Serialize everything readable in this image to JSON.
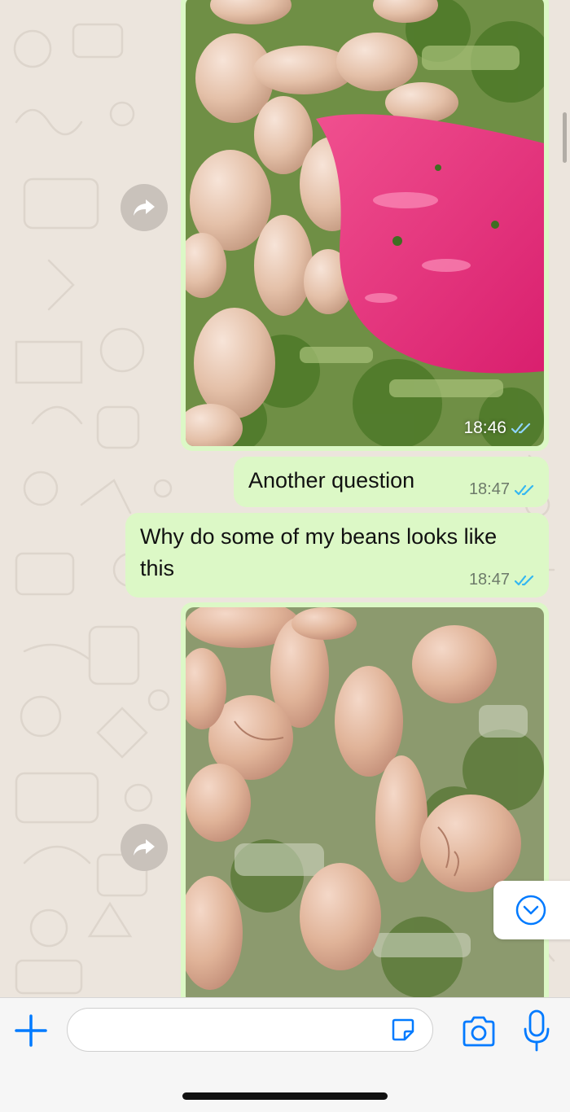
{
  "colors": {
    "bubble_outgoing": "#dcf8c6",
    "wallpaper": "#ece5dd",
    "read_ticks": "#34b7f1",
    "accent": "#007aff"
  },
  "messages": [
    {
      "type": "image",
      "description": "beans-with-pink-spoon",
      "time": "18:46",
      "status": "read"
    },
    {
      "type": "text",
      "text": "Another question",
      "time": "18:47",
      "status": "read"
    },
    {
      "type": "text",
      "text": "Why do some of my beans looks like this",
      "time": "18:47",
      "status": "read"
    },
    {
      "type": "image",
      "description": "beans-split-open",
      "status": "read"
    }
  ],
  "composer": {
    "input_value": "",
    "icons": [
      "plus-icon",
      "sticker-icon",
      "camera-icon",
      "microphone-icon"
    ]
  },
  "scroll_down_icon": "chevron-down-circle-icon",
  "forward_icon": "forward-arrow-icon"
}
